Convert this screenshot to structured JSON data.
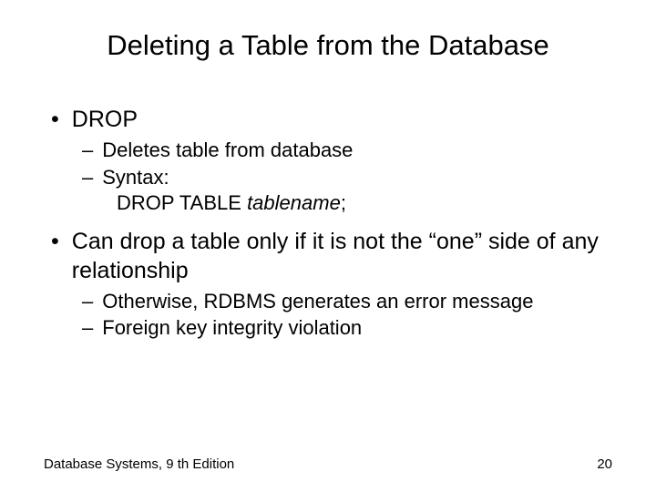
{
  "title": "Deleting a Table from the Database",
  "bullets": {
    "b1": "DROP",
    "b1_sub1": "Deletes table from database",
    "b1_sub2": "Syntax:",
    "b1_code_prefix": "DROP TABLE ",
    "b1_code_italic": "tablename",
    "b1_code_suffix": ";",
    "b2": "Can drop a table only if it is not the “one” side of any relationship",
    "b2_sub1": "Otherwise, RDBMS generates an error message",
    "b2_sub2": "Foreign key integrity violation"
  },
  "footer": {
    "left": "Database Systems, 9 th Edition",
    "right": "20"
  }
}
